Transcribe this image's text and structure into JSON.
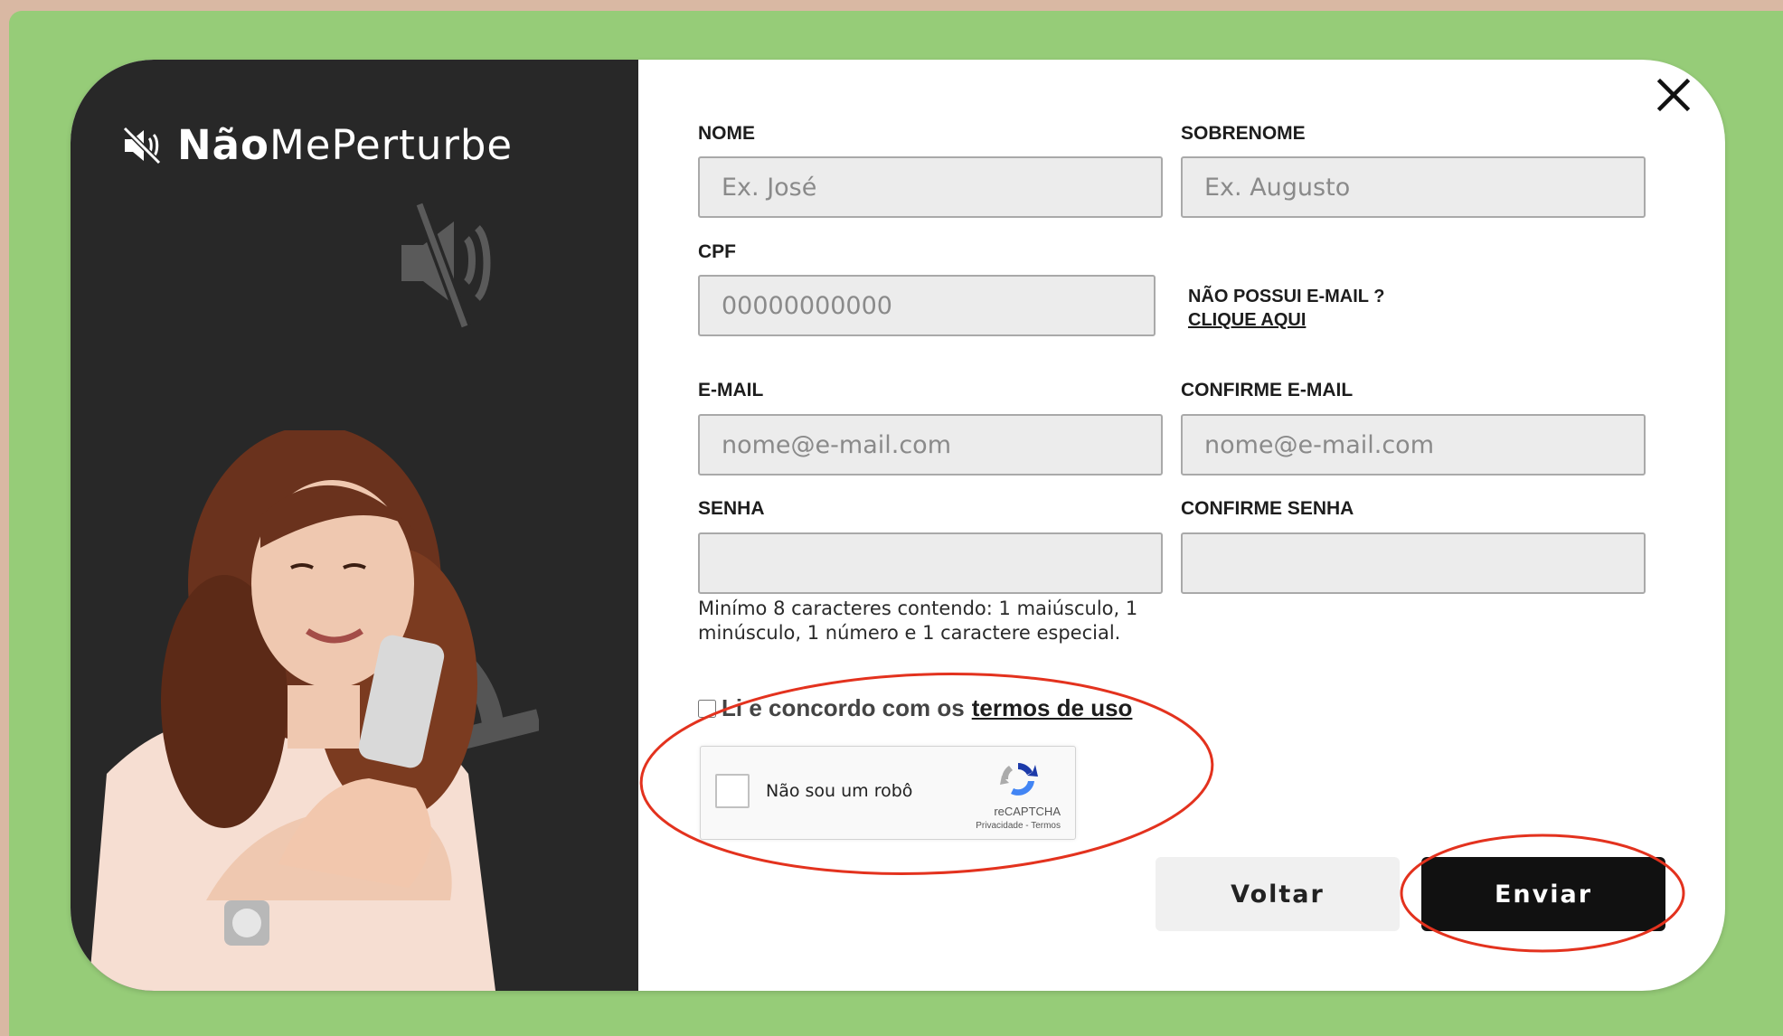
{
  "brand": {
    "bold": "Não",
    "regular": "MePerturbe"
  },
  "form": {
    "nome": {
      "label": "NOME",
      "placeholder": "Ex. José"
    },
    "sobrenome": {
      "label": "SOBRENOME",
      "placeholder": "Ex. Augusto"
    },
    "cpf": {
      "label": "CPF",
      "placeholder": "00000000000"
    },
    "no_email": {
      "question": "NÃO POSSUI E-MAIL ?",
      "link": "CLIQUE AQUI"
    },
    "email": {
      "label": "E-MAIL",
      "placeholder": "nome@e-mail.com"
    },
    "confirm_email": {
      "label": "CONFIRME E-MAIL",
      "placeholder": "nome@e-mail.com"
    },
    "senha": {
      "label": "SENHA",
      "placeholder": ""
    },
    "confirm_senha": {
      "label": "CONFIRME SENHA",
      "placeholder": ""
    },
    "password_hint": "Minímo 8 caracteres contendo: 1 maiúsculo, 1 minúsculo, 1 número e 1 caractere especial.",
    "terms": {
      "text": "Li e concordo com os",
      "link": "termos de uso"
    }
  },
  "captcha": {
    "text": "Não sou um robô",
    "brand": "reCAPTCHA",
    "links": "Privacidade - Termos"
  },
  "buttons": {
    "back": "Voltar",
    "send": "Enviar"
  },
  "colors": {
    "green_bg": "#96cc78",
    "dark_panel": "#282828",
    "annotation_red": "#e3321e"
  },
  "icons": {
    "close": "close-icon",
    "brand": "muted-speaker-icon",
    "captcha": "recaptcha-logo-icon"
  }
}
